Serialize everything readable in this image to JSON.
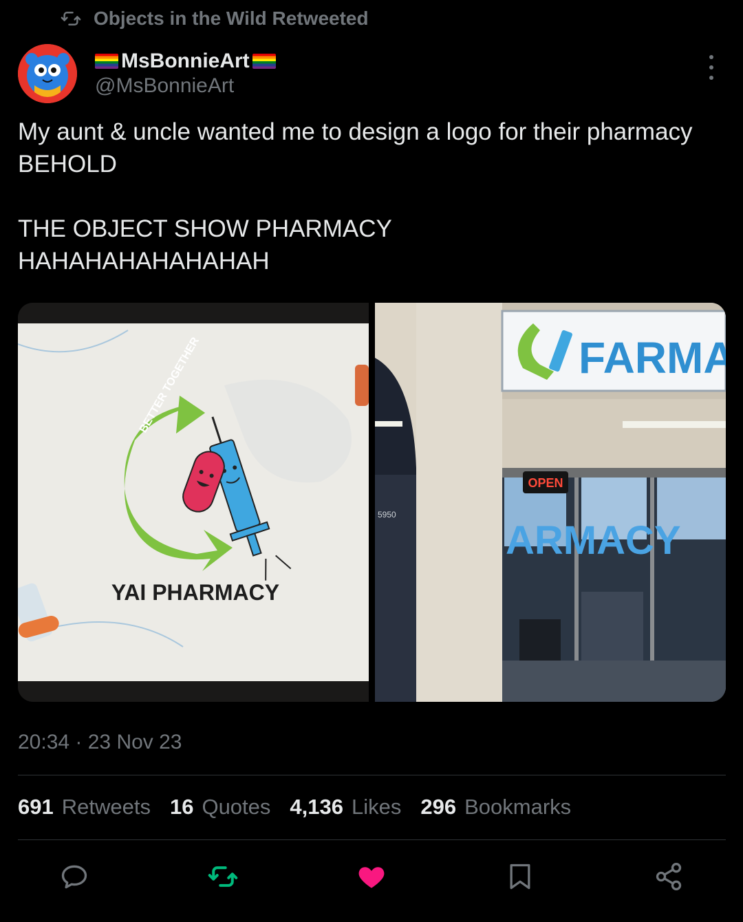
{
  "retweet_context": {
    "text": "Objects in the Wild Retweeted",
    "icon": "retweet-icon"
  },
  "author": {
    "display_name": "MsBonnieArt",
    "handle": "@MsBonnieArt",
    "avatar_icon": "blue-bear-avatar"
  },
  "tweet": {
    "text": "My aunt & uncle wanted me to design a logo for their pharmacy\nBEHOLD\n\nTHE OBJECT SHOW PHARMACY\nHAHAHAHAHAHAHAH"
  },
  "media": {
    "left": {
      "arrow_text": "BETTER TOGETHER",
      "caption": "YAI PHARMACY"
    },
    "right": {
      "sign_text": "FARMAC",
      "window_text": "ARMACY",
      "open_sign": "OPEN",
      "address": "5950"
    }
  },
  "timestamp": "20:34 · 23 Nov 23",
  "stats": [
    {
      "count": "691",
      "label": "Retweets"
    },
    {
      "count": "16",
      "label": "Quotes"
    },
    {
      "count": "4,136",
      "label": "Likes"
    },
    {
      "count": "296",
      "label": "Bookmarks"
    }
  ],
  "actions": {
    "reply_icon": "reply-icon",
    "retweet_icon": "retweet-icon",
    "like_icon": "heart-icon",
    "bookmark_icon": "bookmark-icon",
    "share_icon": "share-icon"
  },
  "colors": {
    "background": "#000000",
    "text": "#e7e9ea",
    "muted": "#71767b",
    "retweet_green": "#00ba7c",
    "like_pink": "#f91880",
    "divider": "#2f3336"
  }
}
